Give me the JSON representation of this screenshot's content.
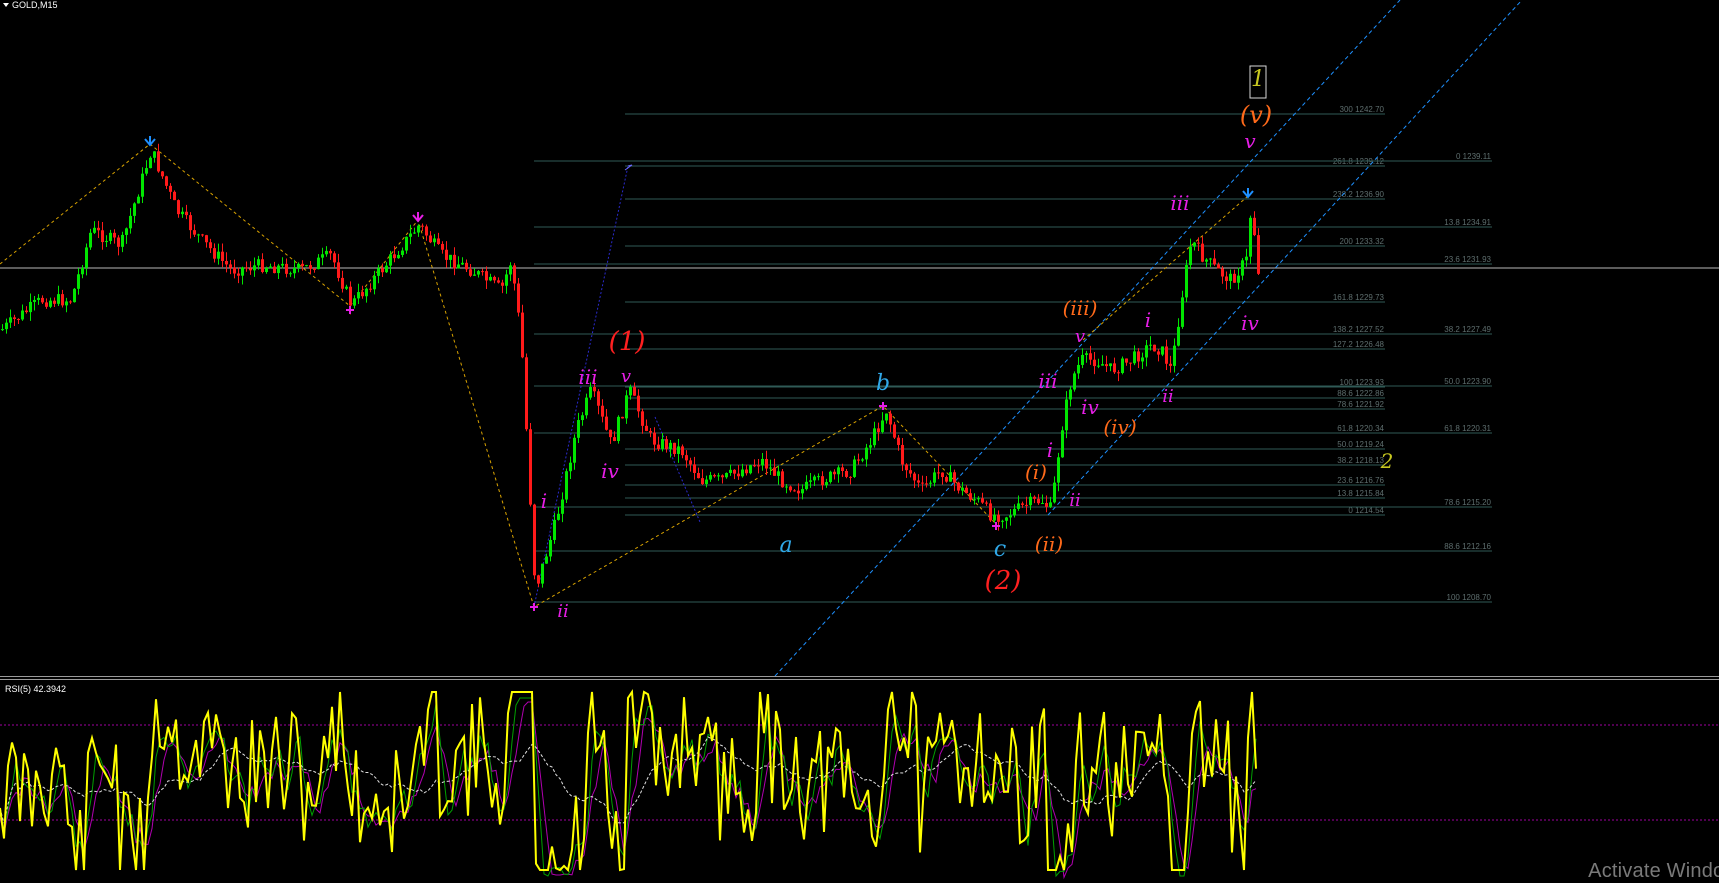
{
  "window": {
    "symbol_title": "GOLD,M15",
    "indicator_title": "RSI(5) 42.3942",
    "watermark": "Activate Window"
  },
  "colors": {
    "background": "#000000",
    "bull_candle": "#00e600",
    "bear_candle": "#ff1a1a",
    "fib_line": "#2f5a56",
    "fib_text": "#5e6e6e",
    "zigzag": "#d8a200",
    "channel": "#1e90ff",
    "rsi_line": "#ffff00",
    "rsi_signal_a": "#00a000",
    "rsi_signal_b": "#b000b0",
    "rsi_ma": "#e0e0e0",
    "rsi_levels": "#a000a0",
    "wave_magenta": "#e61ee6",
    "wave_red": "#ff2020",
    "wave_orange": "#ff6a1a",
    "wave_cyan": "#30a8e8",
    "wave_yellow": "#c8c820"
  },
  "fib_left_labels": [
    "300 1242.70",
    "261.8 1239.12",
    "238.2 1236.90",
    "200 1233.32",
    "161.8 1229.73",
    "138.2 1227.52",
    "127.2 1226.48",
    "100 1223.93",
    "88.6 1222.86",
    "78.6 1221.92",
    "61.8 1220.34",
    "50.0 1219.24",
    "38.2 1218.13",
    "23.6 1216.76",
    "13.8 1215.84",
    "0 1214.54"
  ],
  "fib_right_labels": [
    "0 1239.11",
    "13.8 1234.91",
    "23.6 1231.93",
    "38.2 1227.49",
    "50.0 1223.90",
    "61.8 1220.31",
    "78.6 1215.20",
    "88.6 1212.16",
    "100 1208.70"
  ],
  "wave_labels": [
    {
      "text": "1",
      "color": "wave_yellow"
    },
    {
      "text": "(v)",
      "color": "wave_orange"
    },
    {
      "text": "v",
      "color": "wave_magenta"
    },
    {
      "text": "iii",
      "color": "wave_magenta"
    },
    {
      "text": "iv",
      "color": "wave_magenta"
    },
    {
      "text": "(iii)",
      "color": "wave_orange"
    },
    {
      "text": "v",
      "color": "wave_magenta"
    },
    {
      "text": "i",
      "color": "wave_magenta"
    },
    {
      "text": "iii",
      "color": "wave_magenta"
    },
    {
      "text": "iv",
      "color": "wave_magenta"
    },
    {
      "text": "(iv)",
      "color": "wave_orange"
    },
    {
      "text": "ii",
      "color": "wave_magenta"
    },
    {
      "text": "i",
      "color": "wave_magenta"
    },
    {
      "text": "(i)",
      "color": "wave_orange"
    },
    {
      "text": "ii",
      "color": "wave_magenta"
    },
    {
      "text": "(ii)",
      "color": "wave_orange"
    },
    {
      "text": "c",
      "color": "wave_cyan"
    },
    {
      "text": "(2)",
      "color": "wave_red"
    },
    {
      "text": "2",
      "color": "wave_yellow"
    },
    {
      "text": "b",
      "color": "wave_cyan"
    },
    {
      "text": "a",
      "color": "wave_cyan"
    },
    {
      "text": "(1)",
      "color": "wave_red"
    },
    {
      "text": "v",
      "color": "wave_magenta"
    },
    {
      "text": "iii",
      "color": "wave_magenta"
    },
    {
      "text": "iv",
      "color": "wave_magenta"
    },
    {
      "text": "i",
      "color": "wave_magenta"
    },
    {
      "text": "ii",
      "color": "wave_magenta"
    }
  ]
}
